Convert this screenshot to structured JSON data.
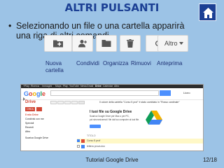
{
  "slide": {
    "title": "ALTRI PULSANTI",
    "bullet_text": "Selezionando un file o una cartella apparirà una riga di altri comandi",
    "footer": "Tutorial Google Drive",
    "page_number": "12/18"
  },
  "toolbar": {
    "altro_label": "Altro",
    "labels": [
      "Nuova cartella",
      "Condividi",
      "Organizza",
      "Rimuovi",
      "Anteprima"
    ]
  },
  "screenshot": {
    "google_bar": [
      "+Play",
      "Ricerca",
      "Immagini",
      "Maps",
      "Play",
      "YouTube",
      "News",
      "Gmail",
      "Drive",
      "Calendar",
      "Altro"
    ],
    "logo_letters": [
      "G",
      "o",
      "o",
      "g",
      "l",
      "e"
    ],
    "user_label": "Liceo",
    "drive_label": "Drive",
    "crea_label": "CREA",
    "sidebar": [
      {
        "label": "Il mio Drive",
        "active": true
      },
      {
        "label": "Condivisi con me",
        "active": false
      },
      {
        "label": "Speciali",
        "active": false
      },
      {
        "label": "Recenti",
        "active": false
      },
      {
        "label": "Altro",
        "active": false
      },
      {
        "label": "Scarica Google Drive",
        "active": false
      }
    ],
    "promo_text": "Il colore della cartella \"Corso 5 prof\" è stato cambiato in \"Rosso cardinale\"",
    "banner_title": "I tuoi file su Google Drive",
    "banner_lines": [
      "Scarica Google Drive per Mac o per PC,",
      "poi sincronizzerai i file dal tuo computer ai tuoi file."
    ],
    "list_header": "TITOLO",
    "rows": [
      {
        "label": "Corso 5 prof",
        "selected": true,
        "color": "#dd4b39"
      },
      {
        "label": "lettera prova.doc",
        "selected": false,
        "color": "#4285f4"
      }
    ]
  },
  "colors": {
    "background": "#9cc3e6",
    "title": "#1b3f94",
    "labels": "#1c2f73",
    "drive_red": "#d14836"
  }
}
